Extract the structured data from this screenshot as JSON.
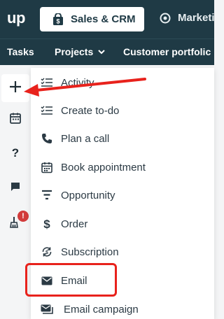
{
  "app": {
    "logo": "up"
  },
  "topbar": {
    "products": [
      {
        "label": "Sales & CRM",
        "icon": "shopping-bag-icon",
        "active": true
      },
      {
        "label": "Marketi",
        "icon": "marketing-icon",
        "active": false
      }
    ]
  },
  "navbar": {
    "items": [
      {
        "label": "Tasks"
      },
      {
        "label": "Projects",
        "has_dropdown": true
      },
      {
        "label": "Customer portfolic"
      }
    ]
  },
  "leftrail": {
    "buttons": [
      {
        "icon": "plus-icon"
      },
      {
        "icon": "calendar-icon"
      },
      {
        "icon": "help-icon"
      },
      {
        "icon": "chat-icon"
      },
      {
        "icon": "broom-icon",
        "badge": "!"
      }
    ]
  },
  "create_menu": {
    "items": [
      {
        "label": "Activity",
        "icon": "checklist-icon"
      },
      {
        "label": "Create to-do",
        "icon": "checklist-icon"
      },
      {
        "label": "Plan a call",
        "icon": "phone-icon"
      },
      {
        "label": "Book appointment",
        "icon": "calendar-icon"
      },
      {
        "label": "Opportunity",
        "icon": "funnel-icon"
      },
      {
        "label": "Order",
        "icon": "dollar-icon"
      },
      {
        "label": "Subscription",
        "icon": "subscription-icon"
      },
      {
        "label": "Email",
        "icon": "envelope-icon",
        "highlighted": true
      },
      {
        "label": "Email campaign",
        "icon": "email-campaign-icon"
      }
    ]
  },
  "colors": {
    "header_bg": "#1f3a45",
    "annotation_red": "#e8221c",
    "badge_red": "#d23b3b",
    "icon_dark": "#2b3a44"
  }
}
